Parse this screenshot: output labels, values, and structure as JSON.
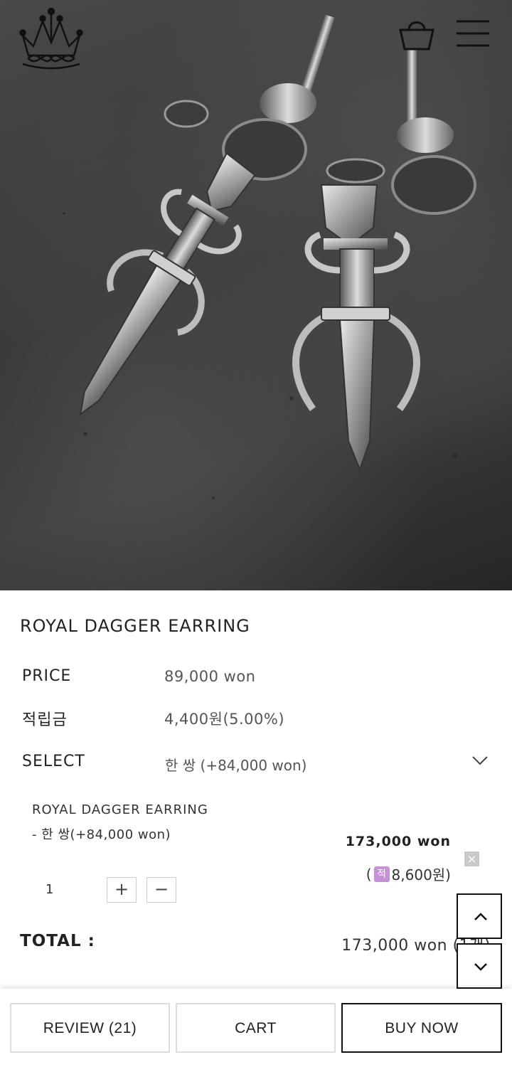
{
  "header": {
    "logo_icon": "crown-infinity-logo-icon",
    "cart_icon": "shopping-basket-icon",
    "menu_icon": "hamburger-menu-icon"
  },
  "product": {
    "name": "ROYAL DAGGER EARRING",
    "price_label": "PRICE",
    "price_value": "89,000 won",
    "points_label": "적립금",
    "points_value": "4,400원(5.00%)",
    "select_label": "SELECT",
    "select_value": "한 쌍 (+84,000 won)"
  },
  "selected_option": {
    "name": "ROYAL DAGGER EARRING",
    "option": "- 한 쌍(+84,000 won)",
    "price": "173,000 won",
    "points_prefix": "(",
    "points_badge": "적",
    "points_value": "8,600원)",
    "remove_label": "×",
    "quantity": "1",
    "plus_label": "+",
    "minus_label": "−"
  },
  "total": {
    "label": "TOTAL :",
    "value": "173,000 won (1개)"
  },
  "scroll": {
    "up_icon": "chevron-up-icon",
    "down_icon": "chevron-down-icon"
  },
  "bottom_bar": {
    "review_label": "REVIEW (21)",
    "cart_label": "CART",
    "buy_label": "BUY NOW"
  },
  "colors": {
    "points_badge": "#c890d8",
    "buy_border": "#111111"
  }
}
